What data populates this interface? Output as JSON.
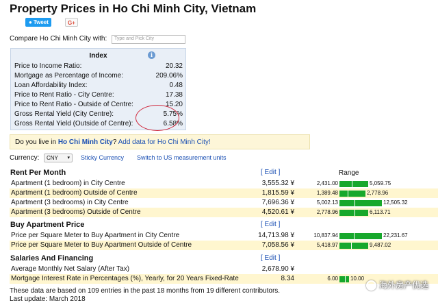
{
  "page": {
    "title": "Property Prices in Ho Chi Minh City, Vietnam"
  },
  "share": {
    "tweet_label": "Tweet",
    "gplus_label": "G+"
  },
  "compare": {
    "label": "Compare Ho Chi Minh City with:",
    "placeholder": "Type and Pick City"
  },
  "index": {
    "header": "Index",
    "rows": [
      {
        "label": "Price to Income Ratio:",
        "value": "20.32"
      },
      {
        "label": "Mortgage as Percentage of Income:",
        "value": "209.06%"
      },
      {
        "label": "Loan Affordability Index:",
        "value": "0.48"
      },
      {
        "label": "Price to Rent Ratio - City Centre:",
        "value": "17.38"
      },
      {
        "label": "Price to Rent Ratio - Outside of Centre:",
        "value": "15.20"
      },
      {
        "label": "Gross Rental Yield (City Centre):",
        "value": "5.75%"
      },
      {
        "label": "Gross Rental Yield (Outside of Centre):",
        "value": "6.58%"
      }
    ]
  },
  "banner": {
    "prefix": "Do you live in ",
    "city": "Ho Chi Minh City",
    "suffix": "? ",
    "link": "Add data for Ho Chi Minh City!"
  },
  "currency": {
    "label": "Currency:",
    "selected": "CNY",
    "sticky_link": "Sticky Currency",
    "us_link": "Switch to US measurement units"
  },
  "range_header": "Range",
  "edit_label": "[ Edit ]",
  "sections": {
    "rent": {
      "title": "Rent Per Month",
      "rows": [
        {
          "label": "Apartment (1 bedroom) in City Centre",
          "value": "3,555.32 ¥",
          "min": "2,431.00",
          "max": "5,059.75",
          "fraction": 0.43
        },
        {
          "label": "Apartment (1 bedroom) Outside of Centre",
          "value": "1,815.59 ¥",
          "min": "1,389.48",
          "max": "2,778.96",
          "fraction": 0.31
        },
        {
          "label": "Apartment (3 bedrooms) in City Centre",
          "value": "7,696.36 ¥",
          "min": "5,002.13",
          "max": "12,505.32",
          "fraction": 0.36
        },
        {
          "label": "Apartment (3 bedrooms) Outside of Centre",
          "value": "4,520.61 ¥",
          "min": "2,778.96",
          "max": "6,113.71",
          "fraction": 0.52
        }
      ]
    },
    "buy": {
      "title": "Buy Apartment Price",
      "rows": [
        {
          "label": "Price per Square Meter to Buy Apartment in City Centre",
          "value": "14,713.98 ¥",
          "min": "10,837.94",
          "max": "22,231.67",
          "fraction": 0.34
        },
        {
          "label": "Price per Square Meter to Buy Apartment Outside of Centre",
          "value": "7,058.56 ¥",
          "min": "5,418.97",
          "max": "9,487.02",
          "fraction": 0.4
        }
      ]
    },
    "salaries": {
      "title": "Salaries And Financing",
      "rows": [
        {
          "label": "Average Monthly Net Salary (After Tax)",
          "value": "2,678.90 ¥"
        },
        {
          "label": "Mortgage Interest Rate in Percentages (%), Yearly, for 20 Years Fixed-Rate",
          "value": "8.34",
          "min": "6.00",
          "max": "10.00",
          "fraction": 0.58
        }
      ]
    }
  },
  "footer": {
    "line1": "These data are based on 109 entries in the past 18 months from 19 different contributors.",
    "line2": "Last update: March 2018"
  },
  "watermark": "海外房产优选",
  "colors": {
    "bar": "#17a82c",
    "highlight_row": "#fff6cf",
    "index_box": "#e9eff7",
    "link": "#1a4fb3",
    "circle": "#d0263b"
  }
}
